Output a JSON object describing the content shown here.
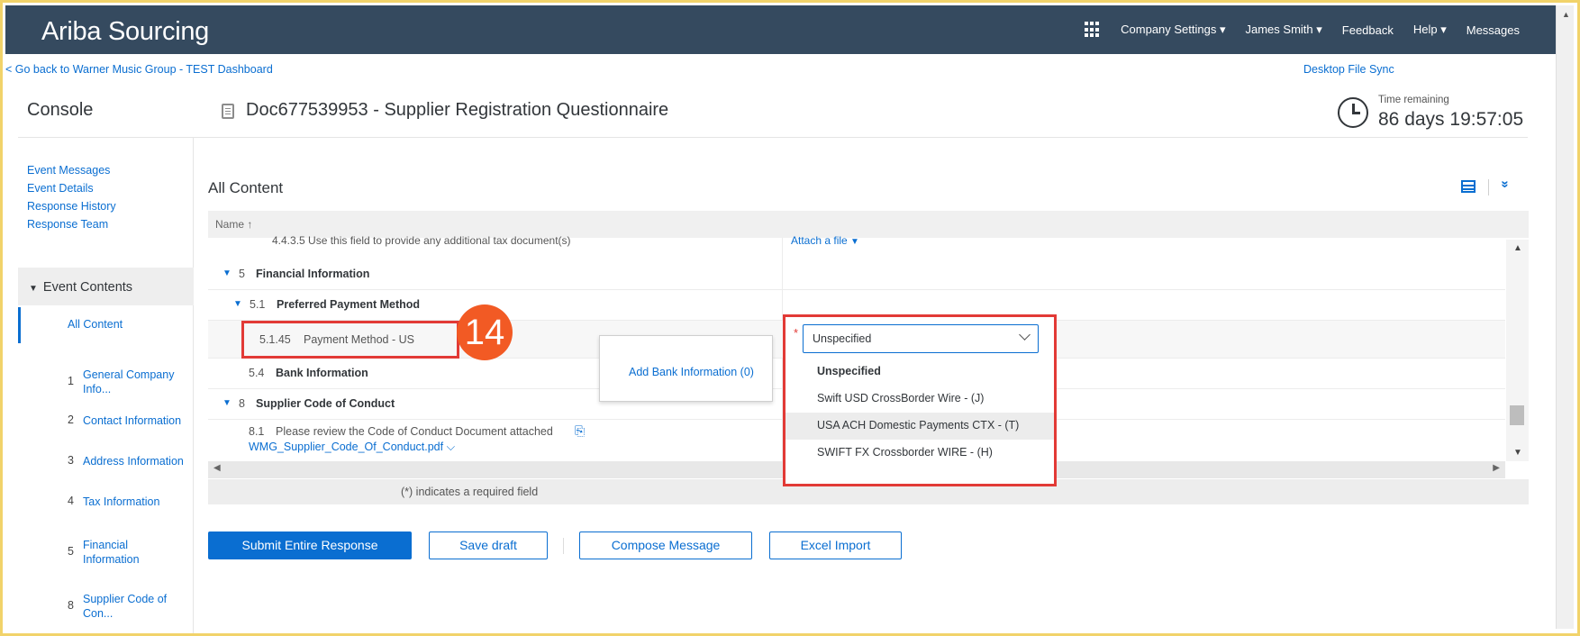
{
  "app": {
    "brand": "Ariba Sourcing",
    "nav": {
      "company_settings": "Company Settings ▾",
      "user": "James Smith ▾",
      "feedback": "Feedback",
      "help": "Help ▾",
      "messages": "Messages"
    }
  },
  "back_link": "< Go back to Warner Music Group - TEST Dashboard",
  "desktop_sync": "Desktop File Sync",
  "console_title": "Console",
  "doc_title": "Doc677539953 - Supplier Registration Questionnaire",
  "time_remaining": {
    "label": "Time remaining",
    "value": "86 days 19:57:05"
  },
  "sidebar": {
    "links": [
      "Event Messages",
      "Event Details",
      "Response History",
      "Response Team"
    ],
    "event_contents": "Event Contents",
    "all_content": "All Content",
    "items": [
      {
        "num": "1",
        "label": "General Company Info..."
      },
      {
        "num": "2",
        "label": "Contact Information"
      },
      {
        "num": "3",
        "label": "Address Information"
      },
      {
        "num": "4",
        "label": "Tax Information"
      },
      {
        "num": "5",
        "label": "Financial Information"
      },
      {
        "num": "8",
        "label": "Supplier Code of Con..."
      }
    ]
  },
  "main": {
    "section_title": "All Content",
    "column_name": "Name ↑",
    "cut_row": {
      "text": "4.4.3.5   Use this field to provide any additional tax document(s)",
      "action": "Attach a file"
    },
    "rows": {
      "financial": {
        "num": "5",
        "label": "Financial Information"
      },
      "preferred_payment": {
        "num": "5.1",
        "label": "Preferred Payment Method"
      },
      "payment_method": {
        "num": "5.1.45",
        "label": "Payment Method - US"
      },
      "bank_info": {
        "num": "5.4",
        "label": "Bank Information"
      },
      "code_of_conduct": {
        "num": "8",
        "label": "Supplier Code of Conduct"
      },
      "review": {
        "num": "8.1",
        "label": "Please review the Code of Conduct Document attached",
        "file": "WMG_Supplier_Code_Of_Conduct.pdf"
      }
    },
    "add_bank_info": "Add Bank Information (0)",
    "callout_number": "14",
    "required_mark": "*",
    "dropdown": {
      "selected": "Unspecified",
      "options": [
        "Unspecified",
        "Swift USD CrossBorder Wire - (J)",
        "USA ACH Domestic Payments CTX - (T)",
        "SWIFT FX Crossborder WIRE - (H)"
      ]
    },
    "required_note": "(*) indicates a required field"
  },
  "buttons": {
    "submit": "Submit Entire Response",
    "save": "Save draft",
    "compose": "Compose Message",
    "excel": "Excel Import"
  },
  "colors": {
    "header_bg": "#354a5f",
    "link": "#0a6ed1",
    "callout_red": "#e23a36",
    "badge_orange": "#f25a24",
    "frame": "#f1d36a"
  }
}
